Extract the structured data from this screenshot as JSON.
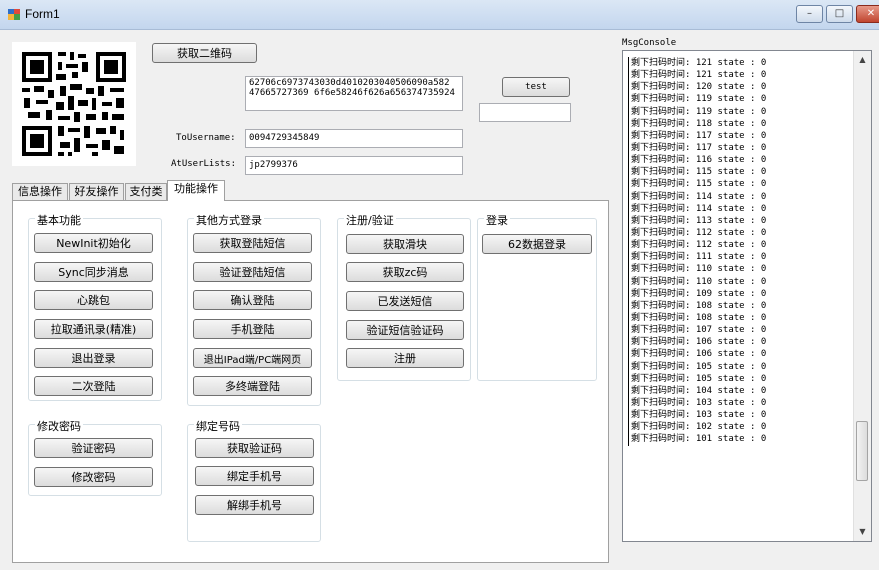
{
  "window": {
    "title": "Form1"
  },
  "top": {
    "get_qr_label": "获取二维码",
    "test_label": "test",
    "data_value": "62706c6973743030d40102030405060908a58247665727369​6f6e58246f626a656374735924",
    "data_line1": "62706c6973743030d4010203040506090a582",
    "data_line2": "47665727369 6f6e58246f626a656374735924",
    "test_input_value": "",
    "to_username_label": "ToUsername:",
    "to_username_value": "0094729345849",
    "at_userlists_label": "AtUserLists:",
    "at_userlists_value": "jp2799376"
  },
  "tabs": [
    {
      "label": "信息操作"
    },
    {
      "label": "好友操作"
    },
    {
      "label": "支付类"
    },
    {
      "label": "功能操作"
    }
  ],
  "groups": {
    "basic": {
      "title": "基本功能",
      "buttons": [
        "NewInit初始化",
        "Sync同步消息",
        "心跳包",
        "拉取通讯录(精准)",
        "退出登录",
        "二次登陆"
      ]
    },
    "other_login": {
      "title": "其他方式登录",
      "buttons": [
        "获取登陆短信",
        "验证登陆短信",
        "确认登陆",
        "手机登陆",
        "退出IPad端/PC端网页",
        "多终端登陆"
      ]
    },
    "register": {
      "title": "注册/验证",
      "buttons": [
        "获取滑块",
        "获取zc码",
        "已发送短信",
        "验证短信验证码",
        "注册"
      ]
    },
    "login": {
      "title": "登录",
      "buttons": [
        "62数据登录"
      ]
    },
    "password": {
      "title": "修改密码",
      "buttons": [
        "验证密码",
        "修改密码"
      ]
    },
    "bind_phone": {
      "title": "绑定号码",
      "buttons": [
        "获取验证码",
        "绑定手机号",
        "解绑手机号"
      ]
    }
  },
  "console": {
    "title": "MsgConsole",
    "lines": [
      "剩下扫码时间: 121 state : 0",
      "剩下扫码时间: 121 state : 0",
      "剩下扫码时间: 120 state : 0",
      "剩下扫码时间: 119 state : 0",
      "剩下扫码时间: 119 state : 0",
      "剩下扫码时间: 118 state : 0",
      "剩下扫码时间: 117 state : 0",
      "剩下扫码时间: 117 state : 0",
      "剩下扫码时间: 116 state : 0",
      "剩下扫码时间: 115 state : 0",
      "剩下扫码时间: 115 state : 0",
      "剩下扫码时间: 114 state : 0",
      "剩下扫码时间: 114 state : 0",
      "剩下扫码时间: 113 state : 0",
      "剩下扫码时间: 112 state : 0",
      "剩下扫码时间: 112 state : 0",
      "剩下扫码时间: 111 state : 0",
      "剩下扫码时间: 110 state : 0",
      "剩下扫码时间: 110 state : 0",
      "剩下扫码时间: 109 state : 0",
      "剩下扫码时间: 108 state : 0",
      "剩下扫码时间: 108 state : 0",
      "剩下扫码时间: 107 state : 0",
      "剩下扫码时间: 106 state : 0",
      "剩下扫码时间: 106 state : 0",
      "剩下扫码时间: 105 state : 0",
      "剩下扫码时间: 105 state : 0",
      "剩下扫码时间: 104 state : 0",
      "剩下扫码时间: 103 state : 0",
      "剩下扫码时间: 103 state : 0",
      "剩下扫码时间: 102 state : 0",
      "剩下扫码时间: 101 state : 0"
    ]
  }
}
